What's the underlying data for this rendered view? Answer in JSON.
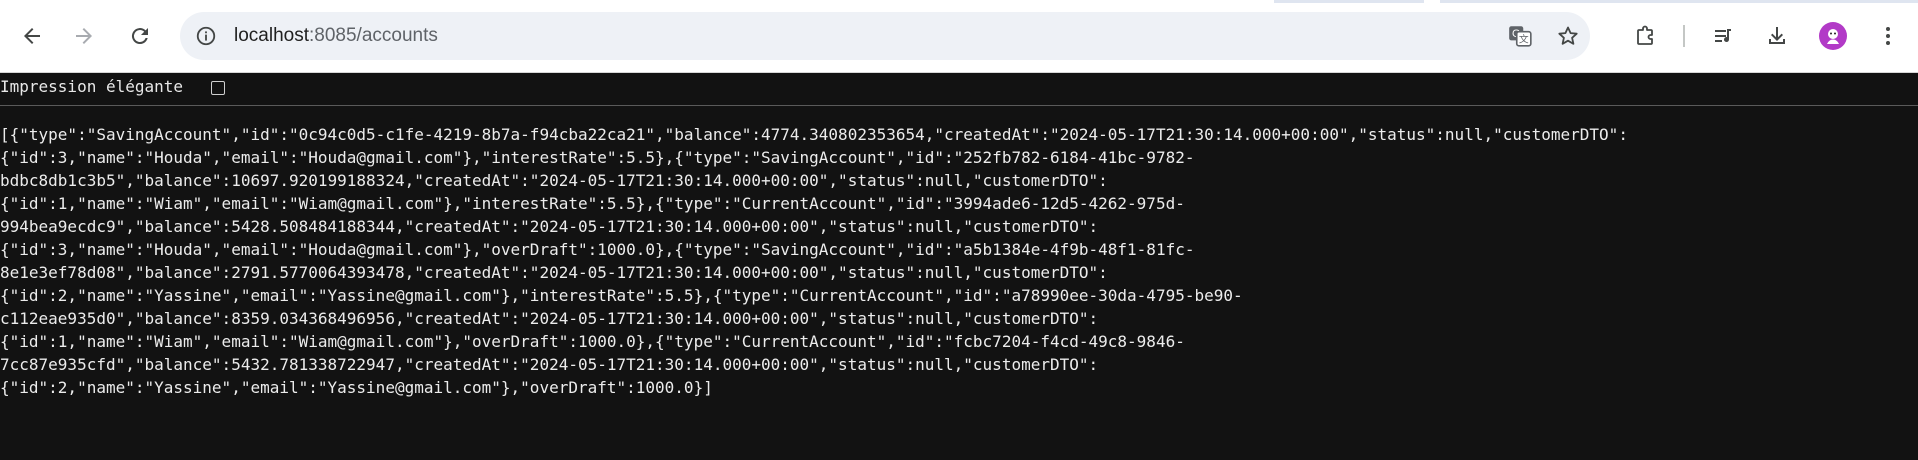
{
  "browser": {
    "url_host": "localhost",
    "url_path": ":8085/accounts",
    "icons": {
      "back": "arrow-back-icon",
      "forward": "arrow-forward-icon",
      "reload": "reload-icon",
      "site_info": "site-info-icon",
      "translate": "translate-icon",
      "bookmark": "star-icon",
      "extensions": "puzzle-icon",
      "media": "media-queue-icon",
      "downloads": "download-icon",
      "profile": "profile-avatar-icon",
      "menu": "kebab-menu-icon"
    }
  },
  "viewer": {
    "pretty_print_label": "Impression élégante",
    "pretty_print_checked": false
  },
  "json_lines": [
    "[{\"type\":\"SavingAccount\",\"id\":\"0c94c0d5-c1fe-4219-8b7a-f94cba22ca21\",\"balance\":4774.340802353654,\"createdAt\":\"2024-05-17T21:30:14.000+00:00\",\"status\":null,\"customerDTO\":",
    "{\"id\":3,\"name\":\"Houda\",\"email\":\"Houda@gmail.com\"},\"interestRate\":5.5},{\"type\":\"SavingAccount\",\"id\":\"252fb782-6184-41bc-9782-",
    "bdbc8db1c3b5\",\"balance\":10697.920199188324,\"createdAt\":\"2024-05-17T21:30:14.000+00:00\",\"status\":null,\"customerDTO\":",
    "{\"id\":1,\"name\":\"Wiam\",\"email\":\"Wiam@gmail.com\"},\"interestRate\":5.5},{\"type\":\"CurrentAccount\",\"id\":\"3994ade6-12d5-4262-975d-",
    "994bea9ecdc9\",\"balance\":5428.508484188344,\"createdAt\":\"2024-05-17T21:30:14.000+00:00\",\"status\":null,\"customerDTO\":",
    "{\"id\":3,\"name\":\"Houda\",\"email\":\"Houda@gmail.com\"},\"overDraft\":1000.0},{\"type\":\"SavingAccount\",\"id\":\"a5b1384e-4f9b-48f1-81fc-",
    "8e1e3ef78d08\",\"balance\":2791.5770064393478,\"createdAt\":\"2024-05-17T21:30:14.000+00:00\",\"status\":null,\"customerDTO\":",
    "{\"id\":2,\"name\":\"Yassine\",\"email\":\"Yassine@gmail.com\"},\"interestRate\":5.5},{\"type\":\"CurrentAccount\",\"id\":\"a78990ee-30da-4795-be90-",
    "c112eae935d0\",\"balance\":8359.034368496956,\"createdAt\":\"2024-05-17T21:30:14.000+00:00\",\"status\":null,\"customerDTO\":",
    "{\"id\":1,\"name\":\"Wiam\",\"email\":\"Wiam@gmail.com\"},\"overDraft\":1000.0},{\"type\":\"CurrentAccount\",\"id\":\"fcbc7204-f4cd-49c8-9846-",
    "7cc87e935cfd\",\"balance\":5432.781338722947,\"createdAt\":\"2024-05-17T21:30:14.000+00:00\",\"status\":null,\"customerDTO\":",
    "{\"id\":2,\"name\":\"Yassine\",\"email\":\"Yassine@gmail.com\"},\"overDraft\":1000.0}]"
  ],
  "colors": {
    "page_background": "#121212",
    "text": "#ececec",
    "toolbar_background": "#ffffff",
    "omnibox_background": "#eef1f6",
    "avatar": "#b23ac7"
  }
}
